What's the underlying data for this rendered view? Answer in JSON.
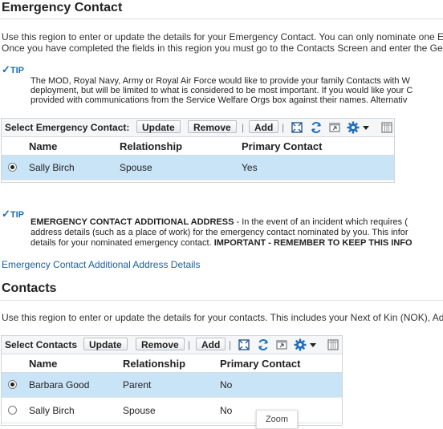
{
  "emergency": {
    "title": "Emergency Contact",
    "intro_line1": "Use this region to enter or update the details for your Emergency Contact. You can only nominate one E",
    "intro_line2": "Once you have completed the fields in this region you must go to the Contacts Screen and enter the Ge",
    "tip1": {
      "label": "TIP",
      "line1": "The MOD, Royal Navy, Army or Royal Air Force would like to provide your family Contacts with W",
      "line2": "deployment, but will be limited to what is considered to be most important. If you would like your C",
      "line3": "provided with communications from the Service Welfare Orgs box against their names. Alternativ"
    },
    "toolbar": {
      "label": "Select Emergency Contact:",
      "update": "Update",
      "remove": "Remove",
      "add": "Add",
      "sep": "|"
    },
    "columns": {
      "name": "Name",
      "relationship": "Relationship",
      "primary": "Primary Contact"
    },
    "rows": [
      {
        "name": "Sally Birch",
        "relationship": "Spouse",
        "primary": "Yes",
        "selected": true
      }
    ],
    "tip2": {
      "label": "TIP",
      "line1_bold": "EMERGENCY CONTACT ADDITIONAL ADDRESS",
      "line1_rest": " - In the event of an incident which requires (",
      "line2": "address details (such as a place of work) for the emergency contact nominated by you. This infor",
      "line3_pre": "details for your nominated emergency contact. ",
      "line3_bold": "IMPORTANT - REMEMBER TO KEEP THIS INFO"
    },
    "link": "Emergency Contact Additional Address Details"
  },
  "contacts": {
    "title": "Contacts",
    "intro": "Use this region to enter or update the details for your contacts. This includes your Next of Kin (NOK), Ad",
    "toolbar": {
      "label": "Select Contacts",
      "update": "Update",
      "remove": "Remove",
      "add": "Add",
      "sep": "|"
    },
    "columns": {
      "name": "Name",
      "relationship": "Relationship",
      "primary": "Primary Contact"
    },
    "rows": [
      {
        "name": "Barbara Good",
        "relationship": "Parent",
        "primary": "No",
        "selected": true
      },
      {
        "name": "Sally Birch",
        "relationship": "Spouse",
        "primary": "No",
        "selected": false
      }
    ]
  },
  "tooltip": {
    "zoom": "Zoom"
  },
  "icons": [
    "zoom-icon",
    "refresh-icon",
    "detach-icon",
    "settings-gear-icon",
    "dropdown-arrow-icon",
    "columns-icon"
  ],
  "colors": {
    "selected_row": "#c9e3f7",
    "tip": "#1a6fb5",
    "link": "#1a5f9e"
  }
}
